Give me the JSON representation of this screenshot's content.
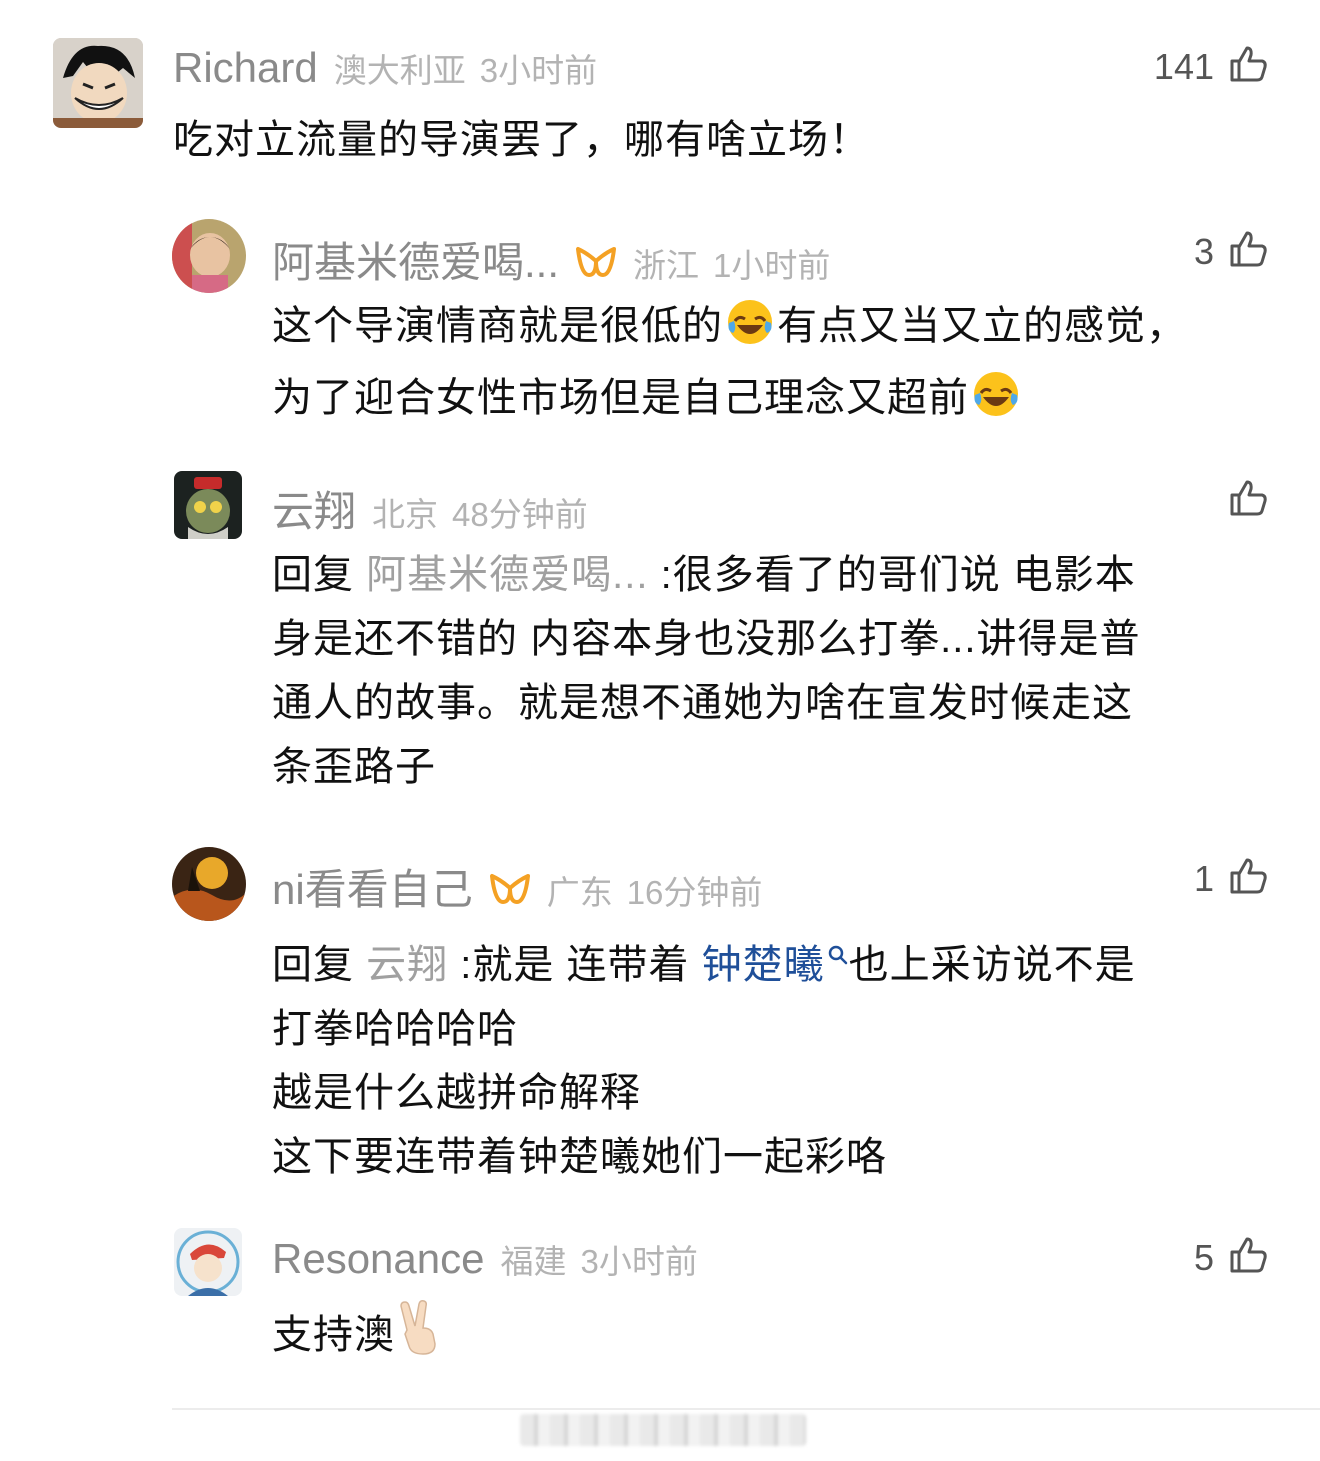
{
  "comments": [
    {
      "name": "Richard",
      "location": "澳大利亚",
      "time": "3小时前",
      "likes": "141",
      "text": [
        "吃对立流量的导演罢了，哪有啥立场！"
      ]
    },
    {
      "name": "阿基米德爱喝...",
      "location": "浙江",
      "time": "1小时前",
      "likes": "3",
      "vip": true,
      "text_l1_a": "这个导演情商就是很低的",
      "text_l1_b": "有点又当又立的感觉，",
      "text_l2": "为了迎合女性市场但是自己理念又超前"
    },
    {
      "name": "云翔",
      "location": "北京",
      "time": "48分钟前",
      "likes": "",
      "reply_prefix": "回复",
      "reply_to": "阿基米德爱喝...",
      "text_l1": " :很多看了的哥们说 电影本",
      "text_l2": "身是还不错的 内容本身也没那么打拳...讲得是普",
      "text_l3": "通人的故事。就是想不通她为啥在宣发时候走这",
      "text_l4": "条歪路子"
    },
    {
      "name": "ni看看自己",
      "location": "广东",
      "time": "16分钟前",
      "likes": "1",
      "vip": true,
      "reply_prefix": "回复",
      "reply_to": "云翔",
      "text_l1_a": " :就是 连带着",
      "text_l1_link": "钟楚曦",
      "text_l1_b": "也上采访说不是",
      "text_l2": "打拳哈哈哈哈",
      "text_l3": "越是什么越拼命解释",
      "text_l4": "这下要连带着钟楚曦她们一起彩咯"
    },
    {
      "name": "Resonance",
      "location": "福建",
      "time": "3小时前",
      "likes": "5",
      "text": "支持澳"
    }
  ],
  "icons": {
    "like": "thumbs-up-icon",
    "vip": "vip-badge-icon",
    "search": "search-icon",
    "laugh": "crying-laughing-emoji",
    "victory": "victory-hand-emoji"
  }
}
